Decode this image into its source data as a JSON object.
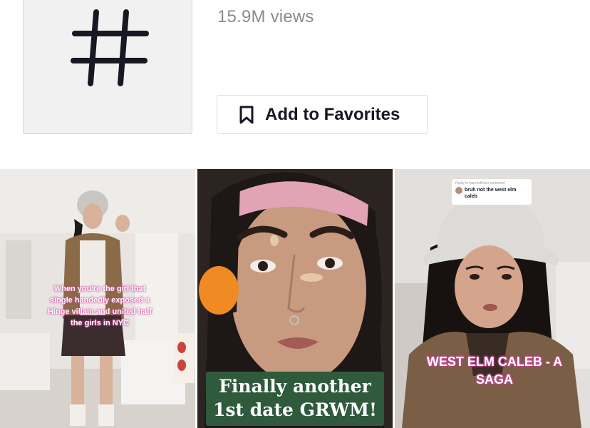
{
  "stats": {
    "views": "15.9M views"
  },
  "actions": {
    "favorites_label": "Add to Favorites"
  },
  "icons": {
    "hashtag": "hashtag-icon",
    "favorites": "bookmark-icon"
  },
  "colors": {
    "text_primary": "#161823",
    "text_secondary": "#8a8b91",
    "caption_green": "#2f5a3c",
    "caption_glow": "#d2459b"
  },
  "videos": [
    {
      "caption": "When you're the girl that single handedly exposed a Hinge villain and united half the girls in NYC"
    },
    {
      "caption": "Finally another 1st date GRWM!"
    },
    {
      "reply_meta": "Reply to bunnieKiss's comment",
      "reply_text": "bruh not the west elm caleb",
      "caption": "WEST ELM CALEB - A SAGA"
    }
  ]
}
